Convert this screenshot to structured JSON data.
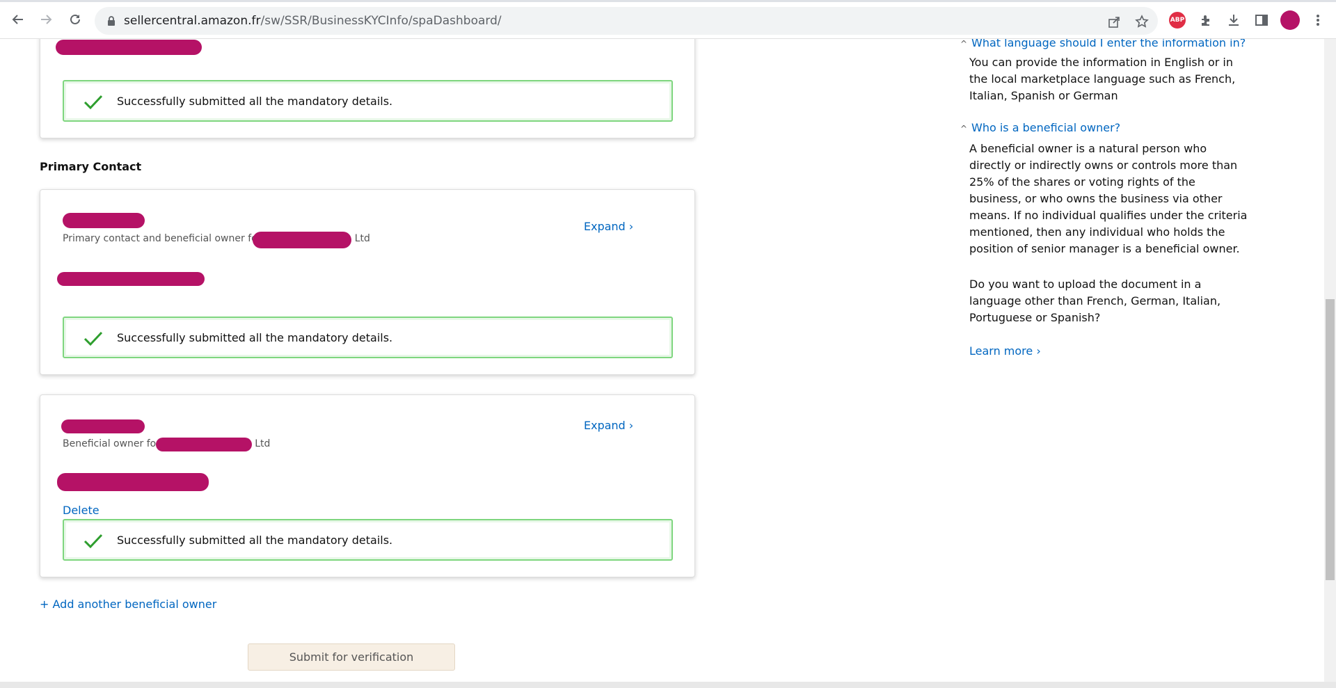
{
  "browser": {
    "url_host": "sellercentral.amazon.fr",
    "url_path": "/sw/SSR/BusinessKYCInfo/spaDashboard/",
    "abp_label": "ABP",
    "icons": [
      "back-icon",
      "forward-icon",
      "reload-icon",
      "lock-icon",
      "share-icon",
      "star-icon",
      "abp-icon",
      "extensions-icon",
      "download-icon",
      "side-panel-icon",
      "profile-avatar",
      "menu-icon"
    ]
  },
  "main": {
    "success_message": "Successfully submitted all the mandatory details.",
    "primary_contact_heading": "Primary Contact",
    "primary_contact_card": {
      "subtitle_prefix": "Primary contact and beneficial owner fo",
      "subtitle_suffix": "Ltd",
      "expand_label": "Expand ›"
    },
    "beneficial_owner_card": {
      "subtitle_prefix": "Beneficial owner fo",
      "subtitle_suffix": "Ltd",
      "expand_label": "Expand ›",
      "delete_label": "Delete"
    },
    "add_owner_label": "+ Add another beneficial owner",
    "submit_label": "Submit for verification"
  },
  "faq": {
    "items": [
      {
        "question": "What language should I enter the information in?",
        "answer": "You can provide the information in English or in the local marketplace language such as French, Italian, Spanish or German"
      },
      {
        "question": "Who is a beneficial owner?",
        "answer": "A beneficial owner is a natural person who directly or indirectly owns or controls more than 25% of the shares or voting rights of the business, or who owns the business via other means. If no individual qualifies under the criteria mentioned, then any individual who holds the position of senior manager is a beneficial owner."
      }
    ],
    "upload_question": "Do you want to upload the document in a language other than French, German, Italian, Portuguese or Spanish?",
    "learn_more_label": "Learn more ›"
  },
  "colors": {
    "link": "#0066c0",
    "success_border": "#7fd67f",
    "check": "#2e9e2e",
    "redaction": "#b51266",
    "submit_bg": "#f7efe4"
  }
}
